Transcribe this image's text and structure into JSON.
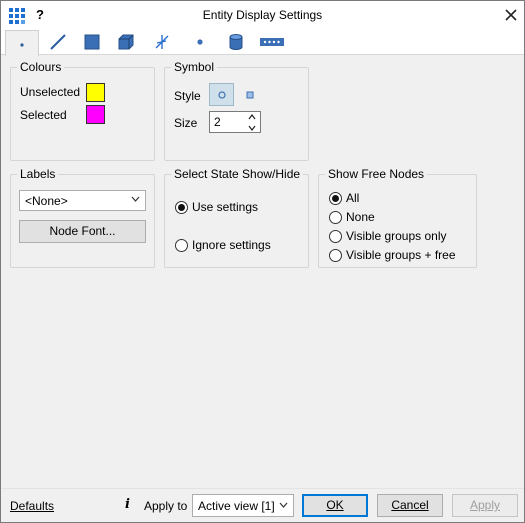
{
  "window": {
    "title": "Entity Display Settings",
    "help": "?",
    "close": "✕"
  },
  "tabs": [
    {
      "name": "node",
      "icon": "node-dot-icon",
      "active": true
    },
    {
      "name": "line",
      "icon": "line-icon"
    },
    {
      "name": "surface",
      "icon": "surface-icon"
    },
    {
      "name": "volume",
      "icon": "volume-icon"
    },
    {
      "name": "joint",
      "icon": "joint-icon"
    },
    {
      "name": "point",
      "icon": "point-icon"
    },
    {
      "name": "cylinder",
      "icon": "cylinder-icon"
    },
    {
      "name": "dotted-line",
      "icon": "dotted-line-icon"
    }
  ],
  "colours": {
    "title": "Colours",
    "unselected_label": "Unselected",
    "unselected_color": "#ffff00",
    "selected_label": "Selected",
    "selected_color": "#ff00ff"
  },
  "symbol": {
    "title": "Symbol",
    "style_label": "Style",
    "size_label": "Size",
    "size_value": "2"
  },
  "labels": {
    "title": "Labels",
    "select_value": "<None>",
    "font_button": "Node Font..."
  },
  "select_state": {
    "title": "Select State Show/Hide",
    "options": [
      "Use settings",
      "Ignore settings"
    ],
    "selected_index": 0
  },
  "free_nodes": {
    "title": "Show Free Nodes",
    "options": [
      "All",
      "None",
      "Visible groups only",
      "Visible groups + free"
    ],
    "selected_index": 0
  },
  "footer": {
    "defaults": "Defaults",
    "info": "i",
    "apply_to_label": "Apply to",
    "apply_to_value": "Active view [1]",
    "ok": "OK",
    "cancel": "Cancel",
    "apply": "Apply"
  }
}
